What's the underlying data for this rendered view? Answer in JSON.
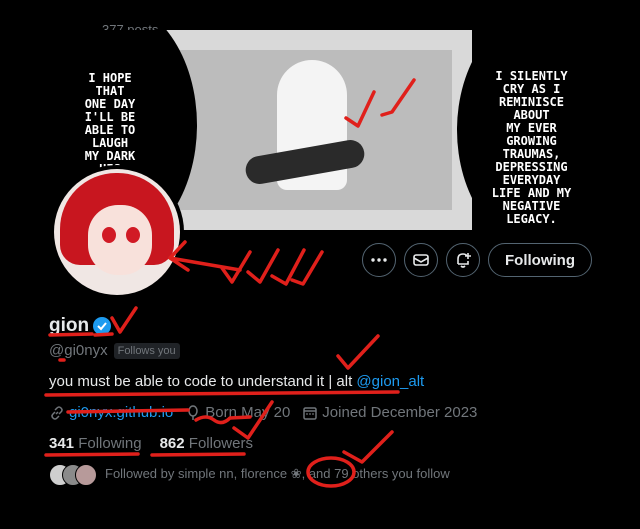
{
  "header": {
    "posts_text": "377 posts"
  },
  "banner": {
    "left_text": "I HOPE\nTHAT\nONE DAY\nI'LL BE\nABLE TO\nLAUGH\nMY DARK\nHIS",
    "right_text": "I SILENTLY\nCRY AS I\nREMINISCE\nABOUT\nMY EVER\nGROWING\nTRAUMAS,\nDEPRESSING\nEVERYDAY\nLIFE AND MY\nNEGATIVE\nLEGACY."
  },
  "actions": {
    "more_icon": "more-icon",
    "message_icon": "mail-icon",
    "notify_icon": "bell-plus-icon",
    "follow_label": "Following"
  },
  "profile": {
    "name": "gion",
    "handle": "@gi0nyx",
    "follows_you": "Follows you",
    "bio_text": "you must be able to code to understand it | alt ",
    "bio_mention": "@gion_alt",
    "website": "gi0nyx.github.io",
    "born": "Born May 20",
    "joined": "Joined December 2023"
  },
  "counts": {
    "following_count": "341",
    "following_label": "Following",
    "followers_count": "862",
    "followers_label": "Followers"
  },
  "followed_by": {
    "text": "Followed by simple nn, florence ❀, and 79 others you follow"
  },
  "colors": {
    "accent": "#1d9bf0",
    "annotation": "#e0201b",
    "muted": "#71767b"
  }
}
